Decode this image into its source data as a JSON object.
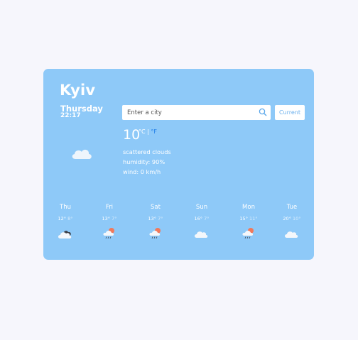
{
  "city": "Kyiv",
  "current": {
    "day": "Thursday",
    "time": "22:17",
    "temperature": "10",
    "unit_c": "°C",
    "separator": "|",
    "unit_f": "°F",
    "description": "scattered clouds",
    "humidity": "humidity: 90%",
    "wind": "wind: 0 km/h",
    "icon": "cloud-icon"
  },
  "search": {
    "placeholder": "Enter a city",
    "button_label": "Current"
  },
  "colors": {
    "card_bg": "#8ec9f8",
    "page_bg": "#f6f6fc",
    "fahrenheit_link": "#1f7ee8",
    "button_text": "#6cb0ec"
  },
  "forecast": [
    {
      "day": "Thu",
      "max": "12°",
      "min": "8°",
      "icon": "night-cloud-icon"
    },
    {
      "day": "Fri",
      "max": "13°",
      "min": "7°",
      "icon": "sun-rain-cloud-icon"
    },
    {
      "day": "Sat",
      "max": "13°",
      "min": "7°",
      "icon": "sun-rain-cloud-icon"
    },
    {
      "day": "Sun",
      "max": "16°",
      "min": "7°",
      "icon": "cloud-icon"
    },
    {
      "day": "Mon",
      "max": "15°",
      "min": "11°",
      "icon": "sun-rain-cloud-icon"
    },
    {
      "day": "Tue",
      "max": "20°",
      "min": "10°",
      "icon": "cloud-icon"
    }
  ]
}
